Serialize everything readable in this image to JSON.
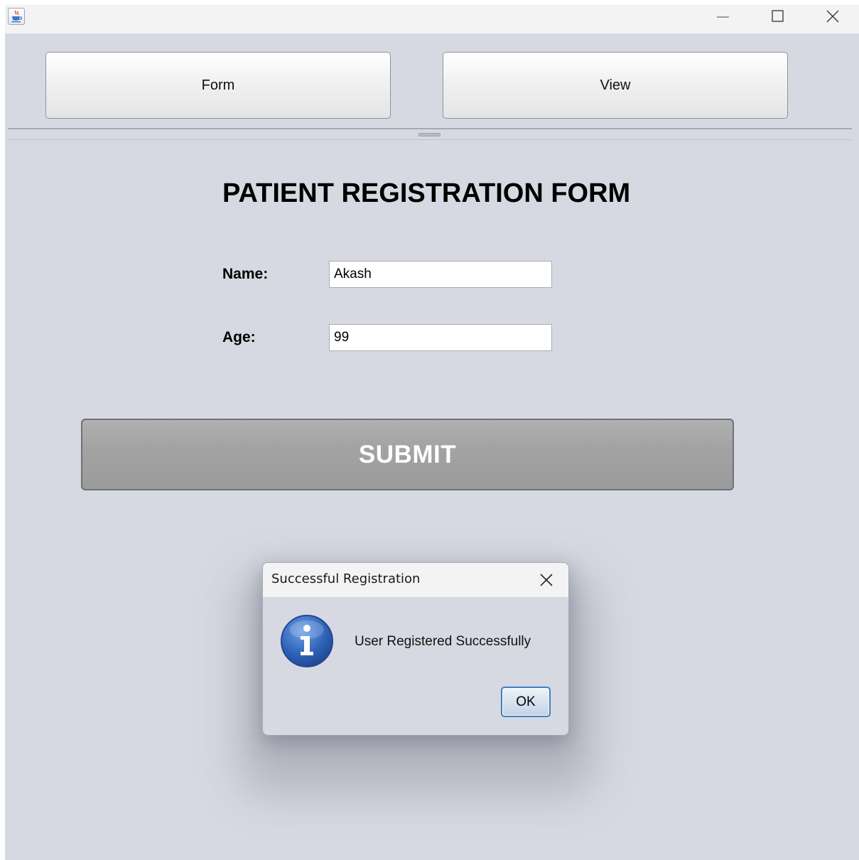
{
  "window": {
    "icon": "java-coffee-cup-icon",
    "controls": [
      "minimize-icon",
      "maximize-icon",
      "close-icon"
    ]
  },
  "tabs": {
    "form_label": "Form",
    "view_label": "View"
  },
  "form": {
    "title": "PATIENT REGISTRATION FORM",
    "name_label": "Name:",
    "name_value": "Akash",
    "age_label": "Age:",
    "age_value": "99",
    "submit_label": "SUBMIT"
  },
  "dialog": {
    "title": "Successful Registration",
    "message": "User Registered Successfully",
    "ok_label": "OK",
    "icon": "info-icon",
    "accent": "#2f64b8"
  }
}
